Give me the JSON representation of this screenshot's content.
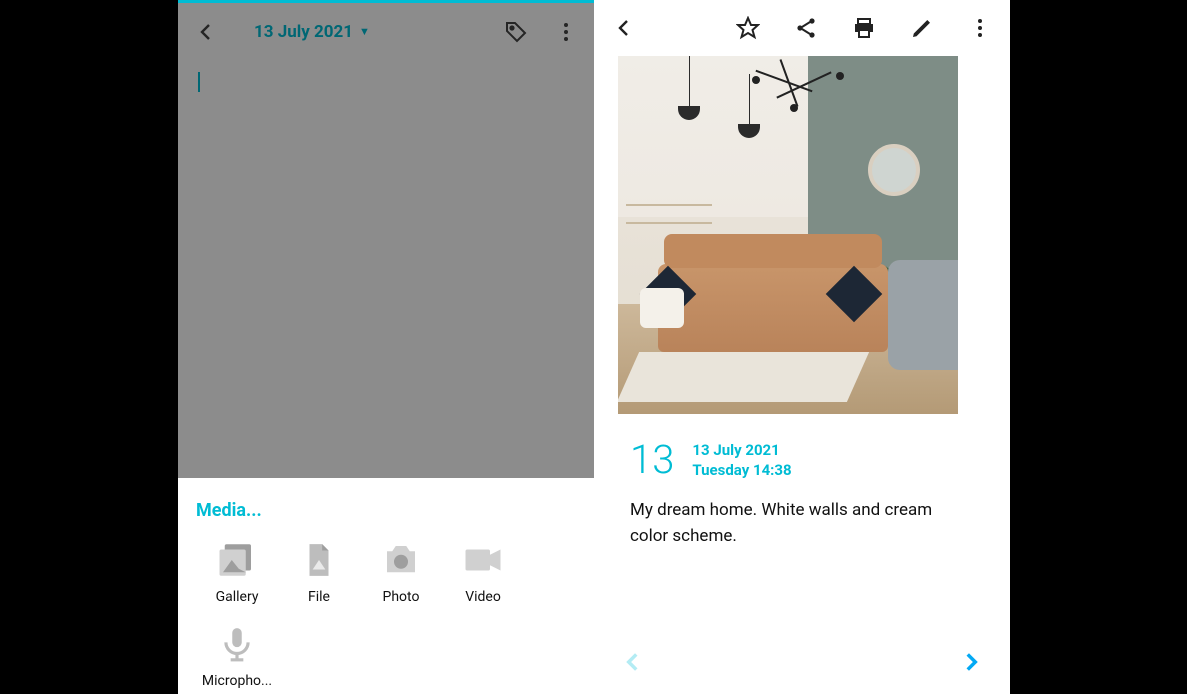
{
  "colors": {
    "accent": "#00bcd4"
  },
  "left": {
    "toolbar": {
      "date": "13 July 2021"
    },
    "sheet": {
      "title": "Media...",
      "items": [
        {
          "label": "Gallery"
        },
        {
          "label": "File"
        },
        {
          "label": "Photo"
        },
        {
          "label": "Video"
        },
        {
          "label": "Micropho..."
        }
      ]
    }
  },
  "right": {
    "meta": {
      "day_number": "13",
      "date_line": "13 July 2021",
      "day_time": "Tuesday 14:38"
    },
    "body": "My dream home. White walls and cream color scheme."
  }
}
